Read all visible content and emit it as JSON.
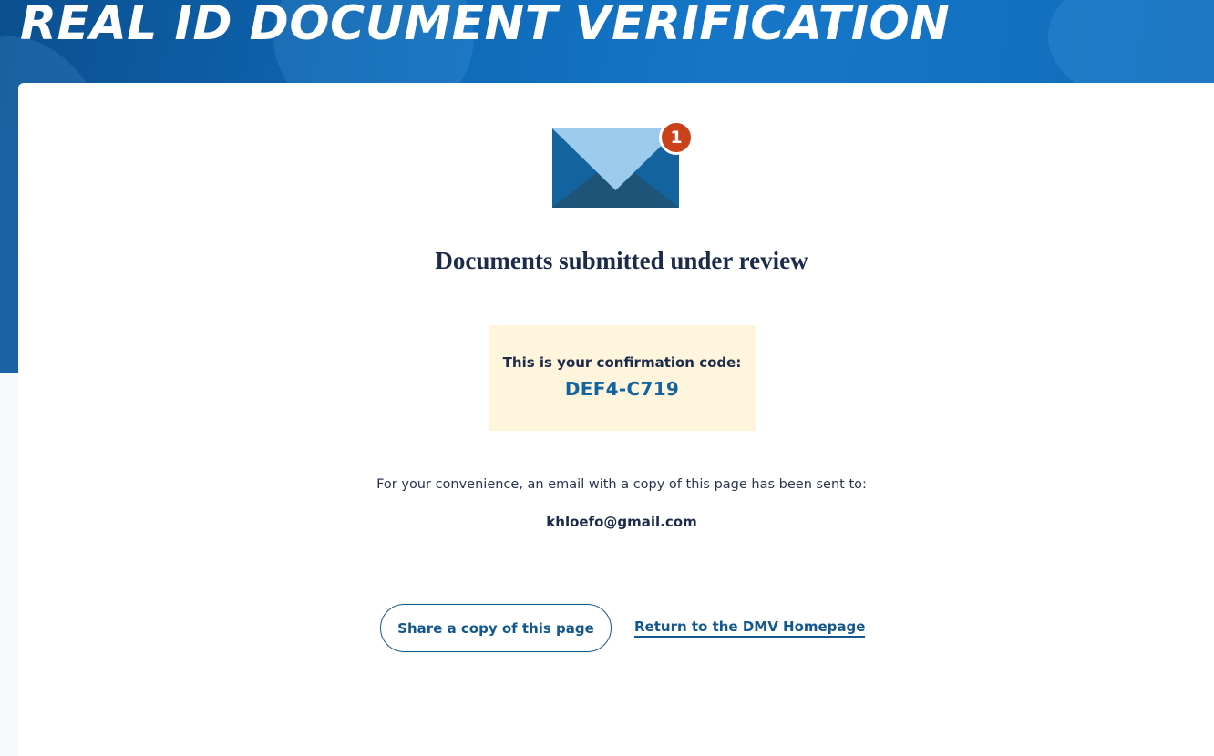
{
  "header": {
    "title": "REAL ID DOCUMENT VERIFICATION"
  },
  "notification": {
    "icon": "envelope-icon",
    "badge_count": "1",
    "colors": {
      "envelope_light": "#9ccbee",
      "envelope_mid": "#13639e",
      "envelope_dark": "#1f5479",
      "badge": "#c9421a"
    }
  },
  "status": {
    "title": "Documents submitted under review"
  },
  "confirmation": {
    "label": "This is your confirmation code:",
    "code": "DEF4-C719"
  },
  "email": {
    "note": "For your convenience, an email with a copy of this page has been sent to:",
    "address": "khloefo@gmail.com"
  },
  "actions": {
    "share_label": "Share a copy of this page",
    "home_label": "Return to the DMV Homepage"
  },
  "theme": {
    "hero_blue": "#0f6ab8",
    "accent": "#13578f",
    "code_bg": "#fff4dc"
  }
}
